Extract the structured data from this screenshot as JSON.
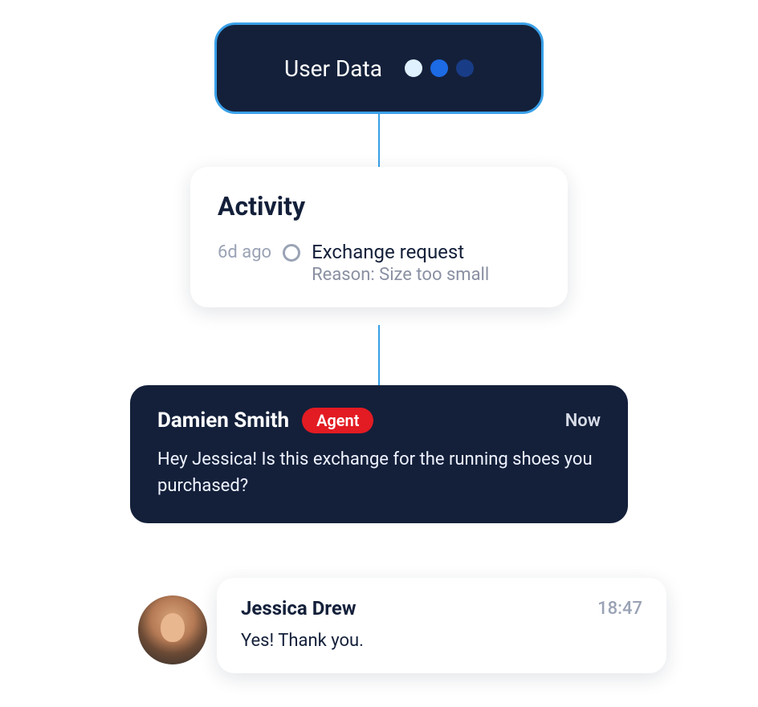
{
  "userdata": {
    "label": "User Data"
  },
  "activity": {
    "title": "Activity",
    "time": "6d ago",
    "event_title": "Exchange request",
    "event_reason": "Reason: Size too small"
  },
  "agent": {
    "name": "Damien Smith",
    "badge": "Agent",
    "time": "Now",
    "message": "Hey Jessica! Is this exchange for the running shoes you purchased?"
  },
  "customer": {
    "name": "Jessica Drew",
    "time": "18:47",
    "message": "Yes! Thank you."
  }
}
